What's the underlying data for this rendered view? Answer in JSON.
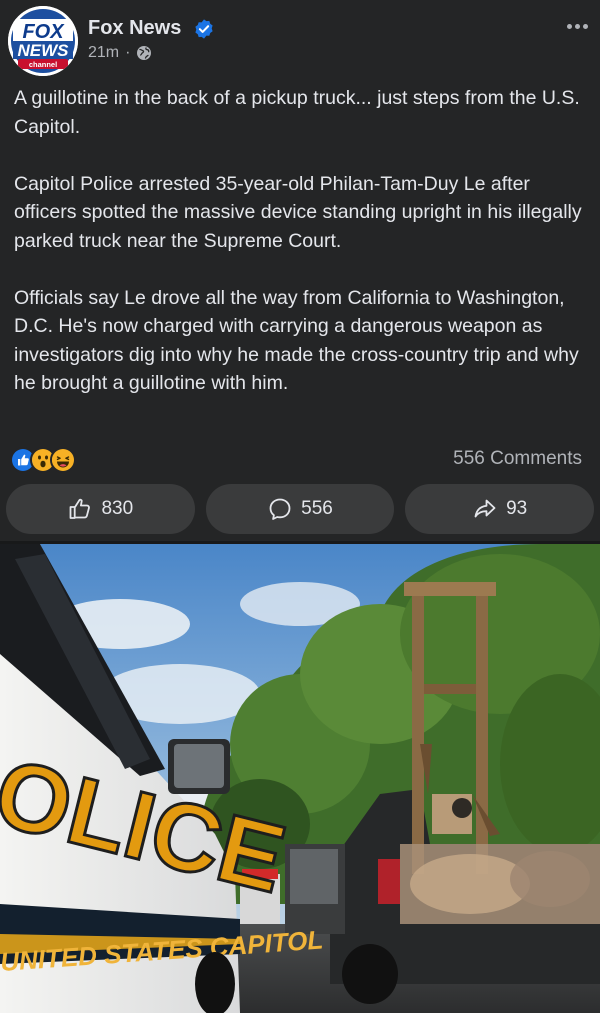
{
  "post": {
    "author": "Fox News",
    "time": "21m",
    "visibility_icon": "globe-icon",
    "verified_icon": "verified-badge-icon",
    "avatar": {
      "logo_text_top": "FOX",
      "logo_text_bottom": "NEWS",
      "logo_subtext": "channel"
    },
    "paragraphs": [
      "A guillotine in the back of a pickup truck... just steps from the U.S. Capitol.",
      "Capitol Police arrested 35-year-old Philan-Tam-Duy Le after officers spotted the massive device standing upright in his illegally parked truck near the Supreme Court.",
      "Officials say Le drove all the way from California to Washington, D.C. He's now charged with carrying a dangerous weapon as investigators dig into why he made the cross-country trip and why he brought a guillotine with him."
    ],
    "reactions": [
      "like-reaction-icon",
      "wow-reaction-icon",
      "haha-reaction-icon"
    ],
    "comments_label": "556 Comments"
  },
  "actions": {
    "like_count": "830",
    "comment_count": "556",
    "share_count": "93"
  },
  "photo": {
    "car_text_main": "OLICE",
    "car_text_sub": "UNITED STATES CAPITOL"
  },
  "colors": {
    "background": "#242526",
    "button_bg": "#3a3b3c",
    "text_primary": "#e4e6eb",
    "text_secondary": "#b0b3b8",
    "verified_blue": "#1b74e4",
    "fox_red": "#c8102e",
    "fox_blue": "#0d3b8c"
  }
}
